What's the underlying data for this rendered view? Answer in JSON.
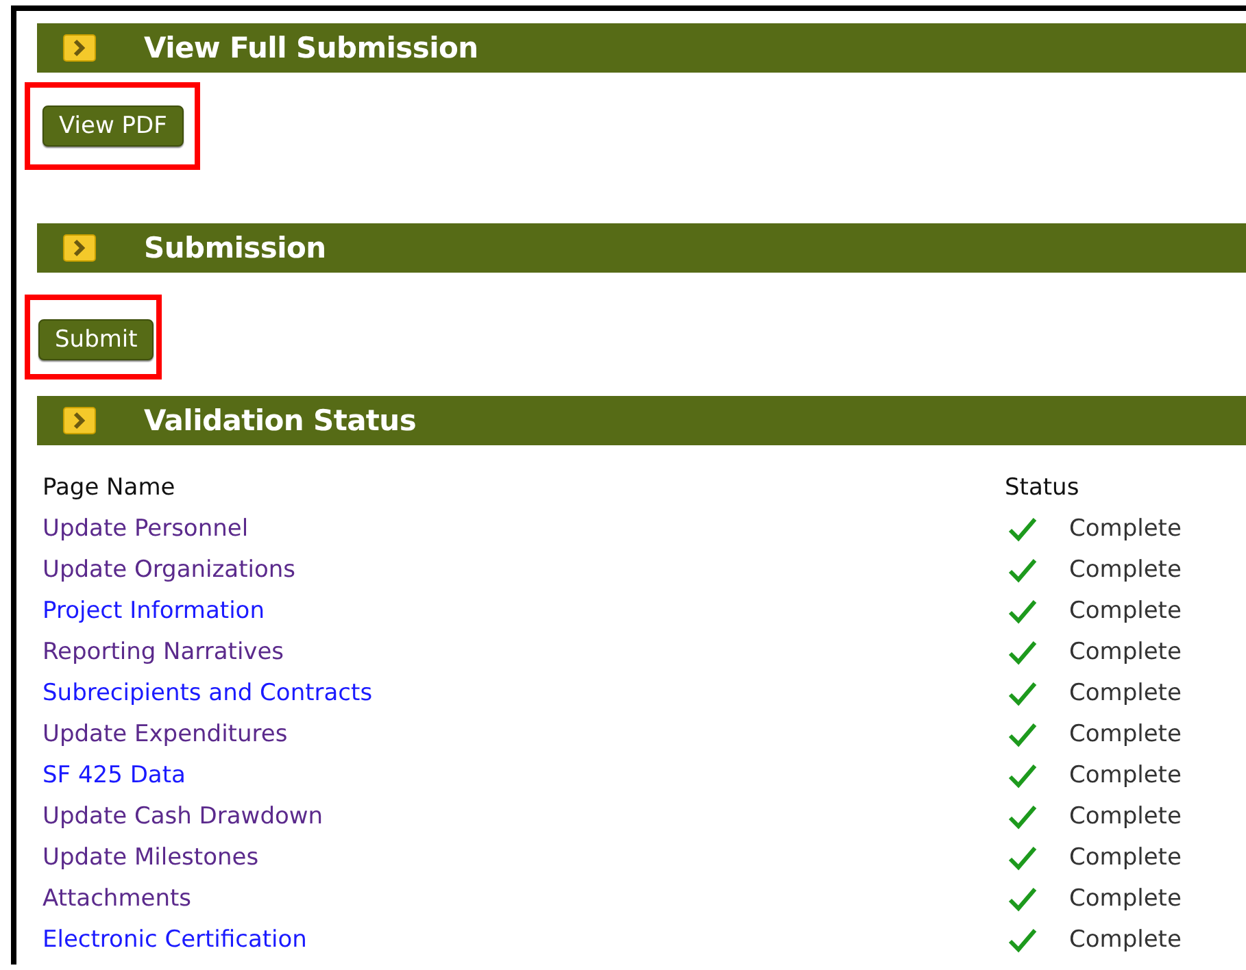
{
  "sections": [
    {
      "title": "View Full Submission",
      "kind": "button",
      "button": {
        "label": "View PDF",
        "highlighted": true
      }
    },
    {
      "title": "Submission",
      "kind": "button",
      "button": {
        "label": "Submit",
        "highlighted": true
      }
    },
    {
      "title": "Validation Status",
      "kind": "table",
      "table": {
        "columns": [
          "Page Name",
          "Status"
        ],
        "rows": [
          {
            "page": "Update Personnel",
            "visited": true,
            "status": "Complete"
          },
          {
            "page": "Update Organizations",
            "visited": true,
            "status": "Complete"
          },
          {
            "page": "Project Information",
            "visited": false,
            "status": "Complete"
          },
          {
            "page": "Reporting Narratives",
            "visited": true,
            "status": "Complete"
          },
          {
            "page": "Subrecipients and Contracts",
            "visited": false,
            "status": "Complete"
          },
          {
            "page": "Update Expenditures",
            "visited": true,
            "status": "Complete"
          },
          {
            "page": "SF 425 Data",
            "visited": false,
            "status": "Complete"
          },
          {
            "page": "Update Cash Drawdown",
            "visited": true,
            "status": "Complete"
          },
          {
            "page": "Update Milestones",
            "visited": true,
            "status": "Complete"
          },
          {
            "page": "Attachments",
            "visited": true,
            "status": "Complete"
          },
          {
            "page": "Electronic Certification",
            "visited": false,
            "status": "Complete"
          }
        ]
      }
    }
  ]
}
